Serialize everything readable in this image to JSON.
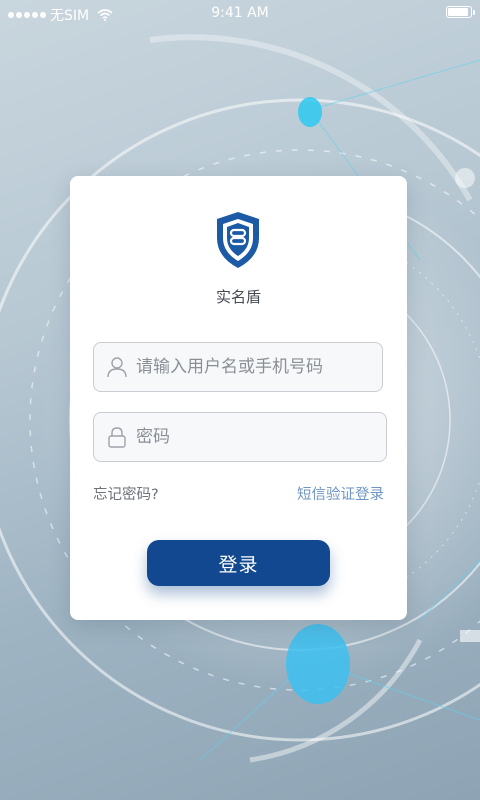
{
  "status_bar": {
    "carrier": "无SIM",
    "time": "9:41 AM",
    "battery_level_percent": 90
  },
  "app": {
    "name": "实名盾",
    "logo_icon": "shield-logo-icon"
  },
  "login_form": {
    "username_placeholder": "请输入用户名或手机号码",
    "password_placeholder": "密码",
    "forgot_password": "忘记密码?",
    "sms_login": "短信验证登录",
    "login_button": "登录"
  },
  "colors": {
    "primary": "#11488f",
    "link": "#6f95c4",
    "accent_glow": "#2ec8f0"
  },
  "icons": [
    "wifi-icon",
    "battery-icon",
    "user-icon",
    "lock-icon",
    "shield-logo-icon"
  ]
}
